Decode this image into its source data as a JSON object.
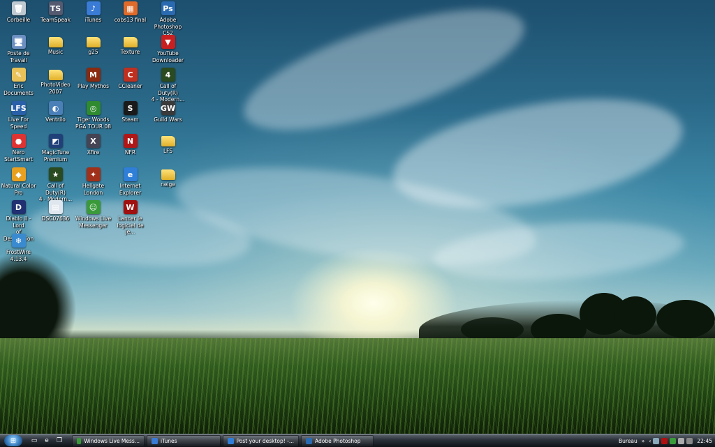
{
  "desktop": {
    "icons": [
      {
        "label": "Corbeille",
        "icon": "recycle-bin-icon",
        "glyph": "🗑",
        "color": "#bfc9d2"
      },
      {
        "label": "Poste de Travail",
        "icon": "computer-icon",
        "glyph": "🖥",
        "color": "#6a8fc0"
      },
      {
        "label": "Eric Documents",
        "icon": "user-folder-icon",
        "glyph": "✎",
        "color": "#e9c25a"
      },
      {
        "label": "Live For Speed",
        "icon": "live-for-speed-icon",
        "glyph": "LFS",
        "color": "#2a60a8"
      },
      {
        "label": "Nero StartSmart",
        "icon": "nero-icon",
        "glyph": "●",
        "color": "#d33"
      },
      {
        "label": "Natural Color\nPro",
        "icon": "natural-color-pro-icon",
        "glyph": "◆",
        "color": "#e8a020"
      },
      {
        "label": "Diablo II - Lord\nof Destruction",
        "icon": "diablo-icon",
        "glyph": "D",
        "color": "#203070"
      },
      {
        "label": "FrostWire 4.13.4",
        "icon": "frostwire-icon",
        "glyph": "❄",
        "color": "#3a8ad0"
      },
      {
        "label": "TeamSpeak",
        "icon": "teamspeak-icon",
        "glyph": "TS",
        "color": "#555a70"
      },
      {
        "label": "Music",
        "icon": "folder-icon",
        "glyph": "",
        "color": "folder"
      },
      {
        "label": "PhotoVideo\n2007",
        "icon": "folder-icon",
        "glyph": "",
        "color": "folder"
      },
      {
        "label": "Ventrilo",
        "icon": "ventrilo-icon",
        "glyph": "◐",
        "color": "#4a7fb8"
      },
      {
        "label": "MagicTune\nPremium",
        "icon": "magictune-icon",
        "glyph": "◩",
        "color": "#20407a"
      },
      {
        "label": "Call of Duty(R)\n4 - Modern...",
        "icon": "call-of-duty-icon",
        "glyph": "★",
        "color": "#2a4a20"
      },
      {
        "label": "DSC07636",
        "icon": "image-file-icon",
        "glyph": "▤",
        "color": "#dfe6ee"
      },
      {
        "label": "iTunes",
        "icon": "itunes-icon",
        "glyph": "♪",
        "color": "#3a7bd5"
      },
      {
        "label": "g25",
        "icon": "folder-icon",
        "glyph": "",
        "color": "folder"
      },
      {
        "label": "Play Mythos",
        "icon": "mythos-icon",
        "glyph": "M",
        "color": "#8a2a10"
      },
      {
        "label": "Tiger Woods\nPGA TOUR 08",
        "icon": "tiger-woods-icon",
        "glyph": "◎",
        "color": "#2f8a30"
      },
      {
        "label": "Xfire",
        "icon": "xfire-icon",
        "glyph": "X",
        "color": "#445"
      },
      {
        "label": "Hellgate\nLondon",
        "icon": "hellgate-icon",
        "glyph": "✦",
        "color": "#a0301a"
      },
      {
        "label": "Windows Live\nMessenger",
        "icon": "messenger-icon",
        "glyph": "☺",
        "color": "#3a9a3a"
      },
      {
        "label": "cobs13 final",
        "icon": "archive-file-icon",
        "glyph": "▦",
        "color": "#e06a2a"
      },
      {
        "label": "Texture",
        "icon": "folder-icon",
        "glyph": "",
        "color": "folder"
      },
      {
        "label": "CCleaner",
        "icon": "ccleaner-icon",
        "glyph": "C",
        "color": "#c03020"
      },
      {
        "label": "Steam",
        "icon": "steam-icon",
        "glyph": "S",
        "color": "#1a1a1a"
      },
      {
        "label": "NFR",
        "icon": "nfr-icon",
        "glyph": "N",
        "color": "#b01818"
      },
      {
        "label": "Internet\nExplorer",
        "icon": "internet-explorer-icon",
        "glyph": "e",
        "color": "#2f7fd8"
      },
      {
        "label": "Lancer le\nlogiciel de je...",
        "icon": "game-launcher-icon",
        "glyph": "W",
        "color": "#a01010"
      },
      {
        "label": "Adobe\nPhotoshop CS2",
        "icon": "photoshop-icon",
        "glyph": "Ps",
        "color": "#2a6ab0"
      },
      {
        "label": "YouTube\nDownloader",
        "icon": "youtube-downloader-icon",
        "glyph": "▼",
        "color": "#c82020"
      },
      {
        "label": "Call of Duty(R)\n4 - Modern...",
        "icon": "call-of-duty-icon",
        "glyph": "4",
        "color": "#2a4a20"
      },
      {
        "label": "Guild Wars",
        "icon": "guild-wars-icon",
        "glyph": "GW",
        "color": "#3a3a3a"
      },
      {
        "label": "LFS",
        "icon": "folder-icon",
        "glyph": "",
        "color": "folder"
      },
      {
        "label": "neige",
        "icon": "folder-icon",
        "glyph": "",
        "color": "folder"
      }
    ]
  },
  "taskbar": {
    "start_icon": "windows-start-icon",
    "quicklaunch": [
      {
        "icon": "show-desktop-icon",
        "glyph": "▭"
      },
      {
        "icon": "internet-explorer-icon",
        "glyph": "e"
      },
      {
        "icon": "switch-windows-icon",
        "glyph": "❐"
      }
    ],
    "tasks": [
      {
        "label": "Windows Live Mess...",
        "icon": "messenger-icon",
        "color": "#3a9a3a"
      },
      {
        "label": "iTunes",
        "icon": "itunes-icon",
        "color": "#3a7bd5"
      },
      {
        "label": "Post your desktop! -...",
        "icon": "browser-icon",
        "color": "#2f7fd8"
      },
      {
        "label": "Adobe Photoshop",
        "icon": "photoshop-icon",
        "color": "#2a6ab0"
      }
    ],
    "tray": {
      "toolbar_label": "Bureau",
      "expand": "»",
      "back": "‹",
      "clock": "22:45"
    }
  }
}
